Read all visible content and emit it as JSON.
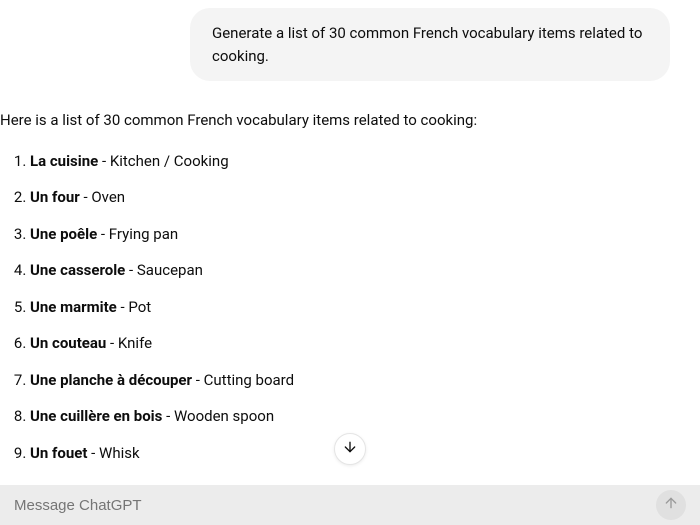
{
  "user_message": "Generate a list of 30 common French vocabulary items related to cooking.",
  "assistant_intro": "Here is a list of 30 common French vocabulary items related to cooking:",
  "vocab": [
    {
      "term": "La cuisine",
      "translation": "Kitchen / Cooking"
    },
    {
      "term": "Un four",
      "translation": "Oven"
    },
    {
      "term": "Une poêle",
      "translation": "Frying pan"
    },
    {
      "term": "Une casserole",
      "translation": "Saucepan"
    },
    {
      "term": "Une marmite",
      "translation": "Pot"
    },
    {
      "term": "Un couteau",
      "translation": "Knife"
    },
    {
      "term": "Une planche à découper",
      "translation": "Cutting board"
    },
    {
      "term": "Une cuillère en bois",
      "translation": "Wooden spoon"
    },
    {
      "term": "Un fouet",
      "translation": "Whisk"
    }
  ],
  "separator": " - ",
  "input_placeholder": "Message ChatGPT"
}
